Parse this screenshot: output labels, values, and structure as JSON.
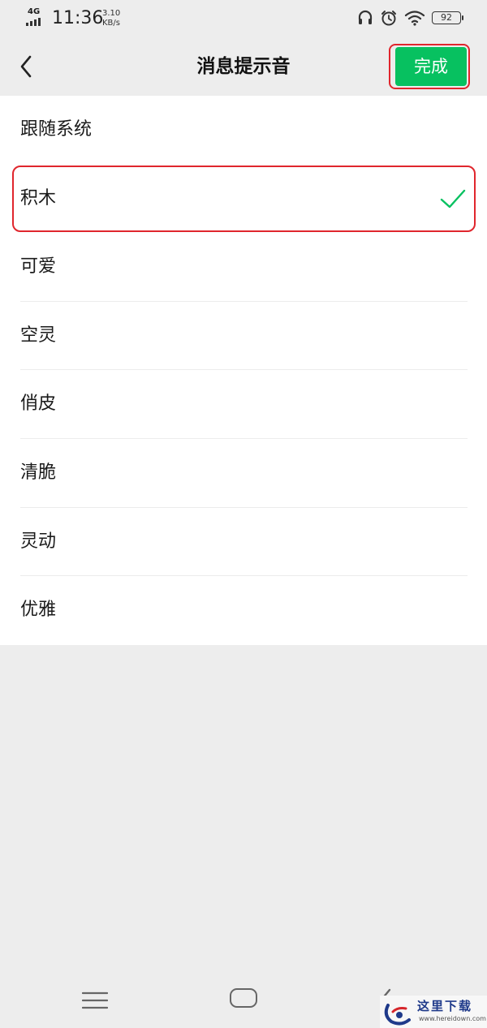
{
  "status_bar": {
    "network": "4G",
    "time": "11:36",
    "speed_value": "3.10",
    "speed_unit": "KB/s",
    "battery": "92",
    "icons": [
      "headphones-icon",
      "alarm-icon",
      "wifi-icon",
      "battery-icon"
    ]
  },
  "header": {
    "back_icon": "chevron-left-icon",
    "title": "消息提示音",
    "done_label": "完成"
  },
  "list": {
    "items": [
      {
        "label": "跟随系统",
        "selected": false
      },
      {
        "label": "积木",
        "selected": true
      },
      {
        "label": "可爱",
        "selected": false
      },
      {
        "label": "空灵",
        "selected": false
      },
      {
        "label": "俏皮",
        "selected": false
      },
      {
        "label": "清脆",
        "selected": false
      },
      {
        "label": "灵动",
        "selected": false
      },
      {
        "label": "优雅",
        "selected": false
      }
    ]
  },
  "nav_bar": {
    "icons": [
      "menu-icon",
      "home-icon",
      "back-icon"
    ]
  },
  "watermark": {
    "title": "这里下载",
    "url": "www.hereidown.com"
  },
  "colors": {
    "accent_green": "#07c160",
    "highlight_red": "#e0262d",
    "background": "#ededed"
  }
}
